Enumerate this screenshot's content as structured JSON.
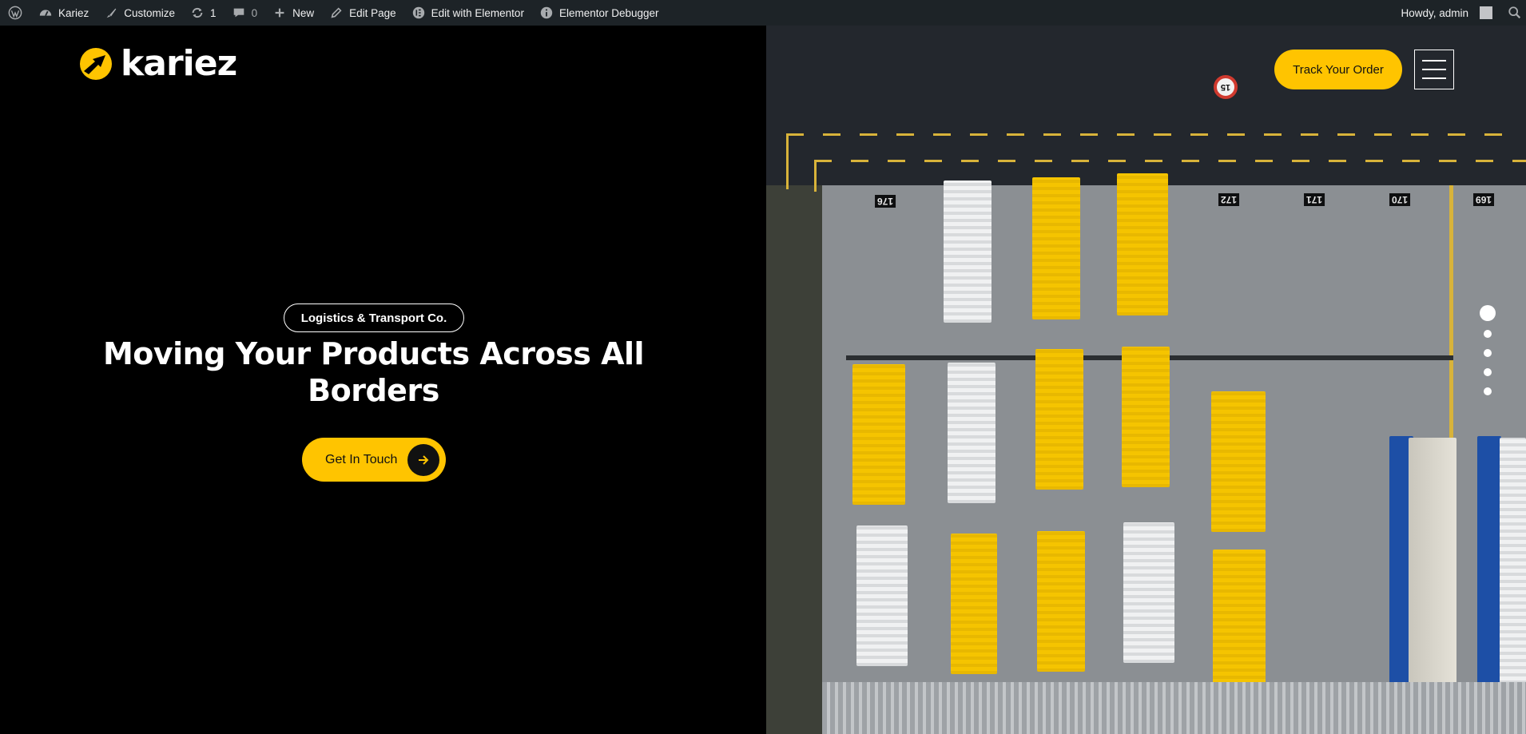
{
  "adminbar": {
    "site_name": "Kariez",
    "customize": "Customize",
    "updates_count": "1",
    "comments_count": "0",
    "new_label": "New",
    "edit_page": "Edit Page",
    "edit_elementor": "Edit with Elementor",
    "elementor_debugger": "Elementor Debugger",
    "howdy": "Howdy, admin"
  },
  "brand": {
    "logo_text": "kariez",
    "accent_color": "#ffc400"
  },
  "hero": {
    "tagline": "Logistics & Transport Co.",
    "headline": "Moving Your Products Across All Borders",
    "cta_label": "Get In Touch"
  },
  "header": {
    "track_label": "Track Your Order"
  },
  "slider": {
    "total_slides": 5,
    "active_slide": 1
  },
  "image": {
    "bay_numbers": [
      "176",
      "172",
      "171",
      "170",
      "169"
    ],
    "sign_number": "15"
  }
}
